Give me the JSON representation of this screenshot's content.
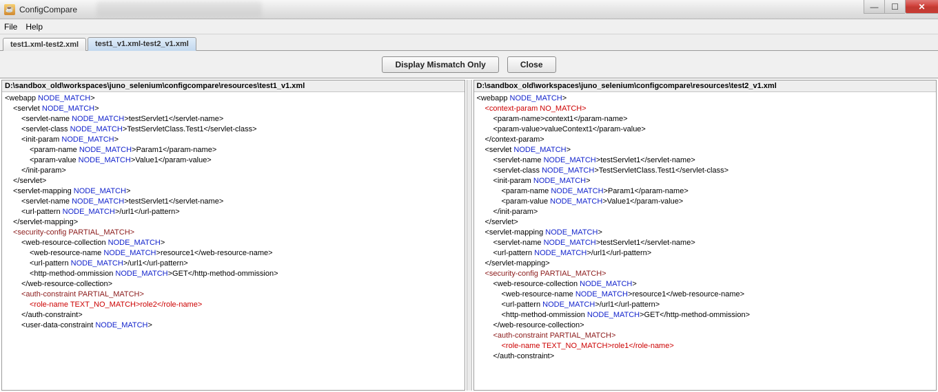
{
  "window": {
    "title": "ConfigCompare"
  },
  "menu": {
    "file": "File",
    "help": "Help"
  },
  "tabs": [
    {
      "label": "test1.xml-test2.xml",
      "active": false
    },
    {
      "label": "test1_v1.xml-test2_v1.xml",
      "active": true
    }
  ],
  "toolbar": {
    "display_mismatch": "Display Mismatch Only",
    "close": "Close"
  },
  "left": {
    "path": "D:\\sandbox_old\\workspaces\\juno_selenium\\configcompare\\resources\\test1_v1.xml",
    "lines": [
      {
        "indent": 0,
        "parts": [
          {
            "t": "<webapp ",
            "c": "black"
          },
          {
            "t": "NODE_MATCH",
            "c": "blue"
          },
          {
            "t": ">",
            "c": "black"
          }
        ]
      },
      {
        "indent": 1,
        "parts": [
          {
            "t": "<servlet ",
            "c": "black"
          },
          {
            "t": "NODE_MATCH",
            "c": "blue"
          },
          {
            "t": ">",
            "c": "black"
          }
        ]
      },
      {
        "indent": 2,
        "parts": [
          {
            "t": "<servlet-name ",
            "c": "black"
          },
          {
            "t": "NODE_MATCH",
            "c": "blue"
          },
          {
            "t": ">testServlet1</servlet-name>",
            "c": "black"
          }
        ]
      },
      {
        "indent": 2,
        "parts": [
          {
            "t": "<servlet-class ",
            "c": "black"
          },
          {
            "t": "NODE_MATCH",
            "c": "blue"
          },
          {
            "t": ">TestServletClass.Test1</servlet-class>",
            "c": "black"
          }
        ]
      },
      {
        "indent": 2,
        "parts": [
          {
            "t": "<init-param ",
            "c": "black"
          },
          {
            "t": "NODE_MATCH",
            "c": "blue"
          },
          {
            "t": ">",
            "c": "black"
          }
        ]
      },
      {
        "indent": 3,
        "parts": [
          {
            "t": "<param-name ",
            "c": "black"
          },
          {
            "t": "NODE_MATCH",
            "c": "blue"
          },
          {
            "t": ">Param1</param-name>",
            "c": "black"
          }
        ]
      },
      {
        "indent": 3,
        "parts": [
          {
            "t": "<param-value ",
            "c": "black"
          },
          {
            "t": "NODE_MATCH",
            "c": "blue"
          },
          {
            "t": ">Value1</param-value>",
            "c": "black"
          }
        ]
      },
      {
        "indent": 2,
        "parts": [
          {
            "t": "</init-param>",
            "c": "black"
          }
        ]
      },
      {
        "indent": 1,
        "parts": [
          {
            "t": "</servlet>",
            "c": "black"
          }
        ]
      },
      {
        "indent": 0,
        "parts": [
          {
            "t": " ",
            "c": "black"
          }
        ]
      },
      {
        "indent": 0,
        "parts": [
          {
            "t": " ",
            "c": "black"
          }
        ]
      },
      {
        "indent": 1,
        "parts": [
          {
            "t": "<servlet-mapping ",
            "c": "black"
          },
          {
            "t": "NODE_MATCH",
            "c": "blue"
          },
          {
            "t": ">",
            "c": "black"
          }
        ]
      },
      {
        "indent": 2,
        "parts": [
          {
            "t": "<servlet-name ",
            "c": "black"
          },
          {
            "t": "NODE_MATCH",
            "c": "blue"
          },
          {
            "t": ">testServlet1</servlet-name>",
            "c": "black"
          }
        ]
      },
      {
        "indent": 2,
        "parts": [
          {
            "t": "<url-pattern ",
            "c": "black"
          },
          {
            "t": "NODE_MATCH",
            "c": "blue"
          },
          {
            "t": ">/url1</url-pattern>",
            "c": "black"
          }
        ]
      },
      {
        "indent": 1,
        "parts": [
          {
            "t": "</servlet-mapping>",
            "c": "black"
          }
        ]
      },
      {
        "indent": 0,
        "parts": [
          {
            "t": " ",
            "c": "black"
          }
        ]
      },
      {
        "indent": 1,
        "parts": [
          {
            "t": "<security-config ",
            "c": "darkred"
          },
          {
            "t": "PARTIAL_MATCH",
            "c": "darkred"
          },
          {
            "t": ">",
            "c": "darkred"
          }
        ]
      },
      {
        "indent": 2,
        "parts": [
          {
            "t": "<web-resource-collection ",
            "c": "black"
          },
          {
            "t": "NODE_MATCH",
            "c": "blue"
          },
          {
            "t": ">",
            "c": "black"
          }
        ]
      },
      {
        "indent": 3,
        "parts": [
          {
            "t": "<web-resource-name ",
            "c": "black"
          },
          {
            "t": "NODE_MATCH",
            "c": "blue"
          },
          {
            "t": ">resource1</web-resource-name>",
            "c": "black"
          }
        ]
      },
      {
        "indent": 3,
        "parts": [
          {
            "t": "<url-pattern ",
            "c": "black"
          },
          {
            "t": "NODE_MATCH",
            "c": "blue"
          },
          {
            "t": ">/url1</url-pattern>",
            "c": "black"
          }
        ]
      },
      {
        "indent": 3,
        "parts": [
          {
            "t": "<http-method-ommission ",
            "c": "black"
          },
          {
            "t": "NODE_MATCH",
            "c": "blue"
          },
          {
            "t": ">GET</http-method-ommission>",
            "c": "black"
          }
        ]
      },
      {
        "indent": 2,
        "parts": [
          {
            "t": "</web-resource-collection>",
            "c": "black"
          }
        ]
      },
      {
        "indent": 0,
        "parts": [
          {
            "t": " ",
            "c": "black"
          }
        ]
      },
      {
        "indent": 2,
        "parts": [
          {
            "t": "<auth-constraint ",
            "c": "darkred"
          },
          {
            "t": "PARTIAL_MATCH",
            "c": "darkred"
          },
          {
            "t": ">",
            "c": "darkred"
          }
        ]
      },
      {
        "indent": 3,
        "parts": [
          {
            "t": "<role-name ",
            "c": "red"
          },
          {
            "t": "TEXT_NO_MATCH",
            "c": "red"
          },
          {
            "t": ">role2</role-name>",
            "c": "red"
          }
        ]
      },
      {
        "indent": 2,
        "parts": [
          {
            "t": "</auth-constraint>",
            "c": "black"
          }
        ]
      },
      {
        "indent": 0,
        "parts": [
          {
            "t": " ",
            "c": "black"
          }
        ]
      },
      {
        "indent": 2,
        "parts": [
          {
            "t": "<user-data-constraint ",
            "c": "black"
          },
          {
            "t": "NODE_MATCH",
            "c": "blue"
          },
          {
            "t": ">",
            "c": "black"
          }
        ]
      }
    ]
  },
  "right": {
    "path": "D:\\sandbox_old\\workspaces\\juno_selenium\\configcompare\\resources\\test2_v1.xml",
    "lines": [
      {
        "indent": 0,
        "parts": [
          {
            "t": "<webapp ",
            "c": "black"
          },
          {
            "t": "NODE_MATCH",
            "c": "blue"
          },
          {
            "t": ">",
            "c": "black"
          }
        ]
      },
      {
        "indent": 1,
        "parts": [
          {
            "t": "<context-param ",
            "c": "red"
          },
          {
            "t": "NO_MATCH",
            "c": "red"
          },
          {
            "t": ">",
            "c": "red"
          }
        ]
      },
      {
        "indent": 2,
        "parts": [
          {
            "t": "<param-name>context1</param-name>",
            "c": "black"
          }
        ]
      },
      {
        "indent": 2,
        "parts": [
          {
            "t": "<param-value>valueContext1</param-value>",
            "c": "black"
          }
        ]
      },
      {
        "indent": 1,
        "parts": [
          {
            "t": "</context-param>",
            "c": "black"
          }
        ]
      },
      {
        "indent": 1,
        "parts": [
          {
            "t": "<servlet ",
            "c": "black"
          },
          {
            "t": "NODE_MATCH",
            "c": "blue"
          },
          {
            "t": ">",
            "c": "black"
          }
        ]
      },
      {
        "indent": 2,
        "parts": [
          {
            "t": "<servlet-name ",
            "c": "black"
          },
          {
            "t": "NODE_MATCH",
            "c": "blue"
          },
          {
            "t": ">testServlet1</servlet-name>",
            "c": "black"
          }
        ]
      },
      {
        "indent": 2,
        "parts": [
          {
            "t": "<servlet-class ",
            "c": "black"
          },
          {
            "t": "NODE_MATCH",
            "c": "blue"
          },
          {
            "t": ">TestServletClass.Test1</servlet-class>",
            "c": "black"
          }
        ]
      },
      {
        "indent": 2,
        "parts": [
          {
            "t": "<init-param ",
            "c": "black"
          },
          {
            "t": "NODE_MATCH",
            "c": "blue"
          },
          {
            "t": ">",
            "c": "black"
          }
        ]
      },
      {
        "indent": 3,
        "parts": [
          {
            "t": "<param-name ",
            "c": "black"
          },
          {
            "t": "NODE_MATCH",
            "c": "blue"
          },
          {
            "t": ">Param1</param-name>",
            "c": "black"
          }
        ]
      },
      {
        "indent": 3,
        "parts": [
          {
            "t": "<param-value ",
            "c": "black"
          },
          {
            "t": "NODE_MATCH",
            "c": "blue"
          },
          {
            "t": ">Value1</param-value>",
            "c": "black"
          }
        ]
      },
      {
        "indent": 2,
        "parts": [
          {
            "t": "</init-param>",
            "c": "black"
          }
        ]
      },
      {
        "indent": 1,
        "parts": [
          {
            "t": "</servlet>",
            "c": "black"
          }
        ]
      },
      {
        "indent": 0,
        "parts": [
          {
            "t": " ",
            "c": "black"
          }
        ]
      },
      {
        "indent": 1,
        "parts": [
          {
            "t": "<servlet-mapping ",
            "c": "black"
          },
          {
            "t": "NODE_MATCH",
            "c": "blue"
          },
          {
            "t": ">",
            "c": "black"
          }
        ]
      },
      {
        "indent": 2,
        "parts": [
          {
            "t": "<servlet-name ",
            "c": "black"
          },
          {
            "t": "NODE_MATCH",
            "c": "blue"
          },
          {
            "t": ">testServlet1</servlet-name>",
            "c": "black"
          }
        ]
      },
      {
        "indent": 2,
        "parts": [
          {
            "t": "<url-pattern ",
            "c": "black"
          },
          {
            "t": "NODE_MATCH",
            "c": "blue"
          },
          {
            "t": ">/url1</url-pattern>",
            "c": "black"
          }
        ]
      },
      {
        "indent": 1,
        "parts": [
          {
            "t": "</servlet-mapping>",
            "c": "black"
          }
        ]
      },
      {
        "indent": 0,
        "parts": [
          {
            "t": " ",
            "c": "black"
          }
        ]
      },
      {
        "indent": 1,
        "parts": [
          {
            "t": "<security-config ",
            "c": "darkred"
          },
          {
            "t": "PARTIAL_MATCH",
            "c": "darkred"
          },
          {
            "t": ">",
            "c": "darkred"
          }
        ]
      },
      {
        "indent": 2,
        "parts": [
          {
            "t": "<web-resource-collection ",
            "c": "black"
          },
          {
            "t": "NODE_MATCH",
            "c": "blue"
          },
          {
            "t": ">",
            "c": "black"
          }
        ]
      },
      {
        "indent": 3,
        "parts": [
          {
            "t": "<web-resource-name ",
            "c": "black"
          },
          {
            "t": "NODE_MATCH",
            "c": "blue"
          },
          {
            "t": ">resource1</web-resource-name>",
            "c": "black"
          }
        ]
      },
      {
        "indent": 3,
        "parts": [
          {
            "t": "<url-pattern ",
            "c": "black"
          },
          {
            "t": "NODE_MATCH",
            "c": "blue"
          },
          {
            "t": ">/url1</url-pattern>",
            "c": "black"
          }
        ]
      },
      {
        "indent": 3,
        "parts": [
          {
            "t": "<http-method-ommission ",
            "c": "black"
          },
          {
            "t": "NODE_MATCH",
            "c": "blue"
          },
          {
            "t": ">GET</http-method-ommission>",
            "c": "black"
          }
        ]
      },
      {
        "indent": 2,
        "parts": [
          {
            "t": "</web-resource-collection>",
            "c": "black"
          }
        ]
      },
      {
        "indent": 0,
        "parts": [
          {
            "t": " ",
            "c": "black"
          }
        ]
      },
      {
        "indent": 2,
        "parts": [
          {
            "t": "<auth-constraint ",
            "c": "darkred"
          },
          {
            "t": "PARTIAL_MATCH",
            "c": "darkred"
          },
          {
            "t": ">",
            "c": "darkred"
          }
        ]
      },
      {
        "indent": 3,
        "parts": [
          {
            "t": "<role-name ",
            "c": "red"
          },
          {
            "t": "TEXT_NO_MATCH",
            "c": "red"
          },
          {
            "t": ">role1</role-name>",
            "c": "red"
          }
        ]
      },
      {
        "indent": 2,
        "parts": [
          {
            "t": "</auth-constraint>",
            "c": "black"
          }
        ]
      }
    ]
  }
}
